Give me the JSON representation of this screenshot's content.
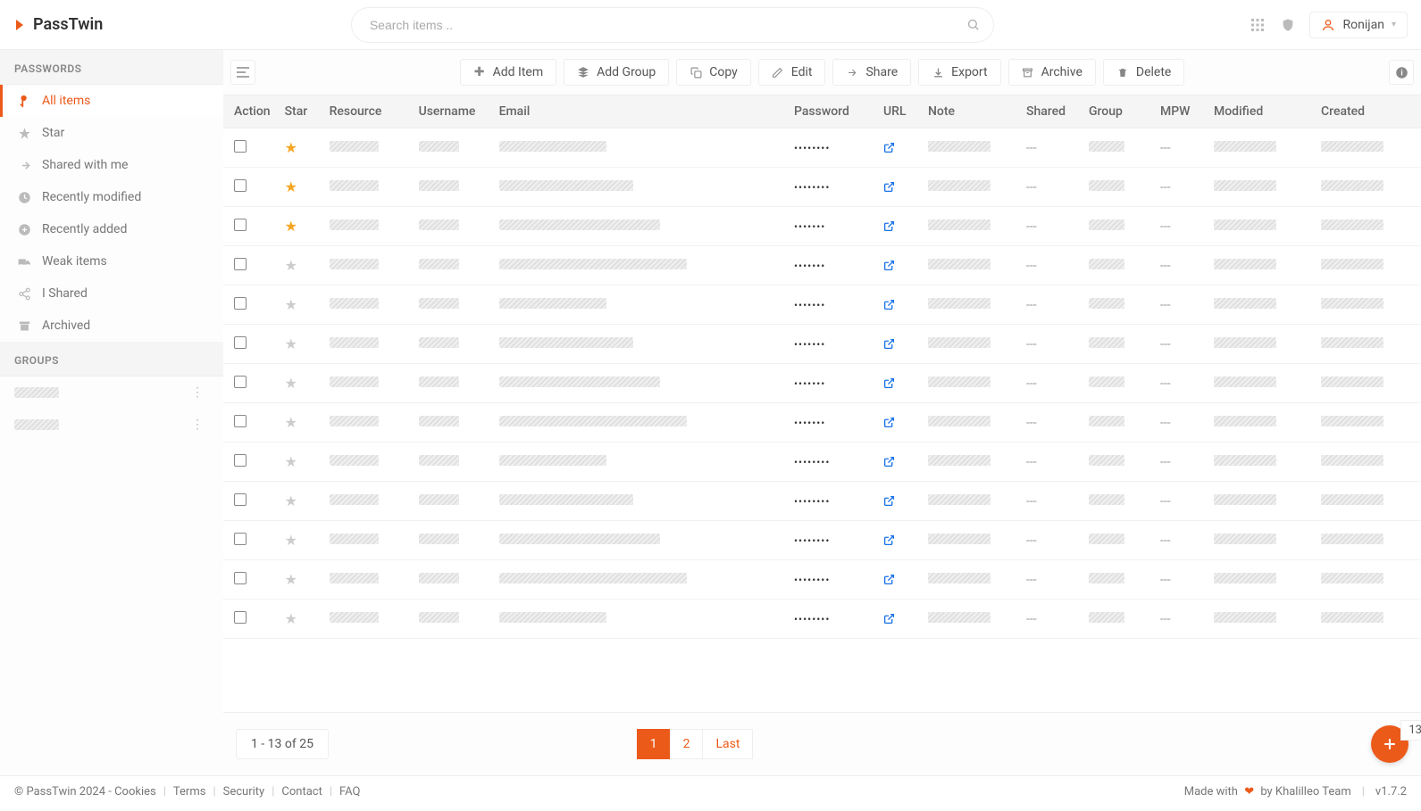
{
  "brand": "PassTwin",
  "search": {
    "placeholder": "Search items .."
  },
  "user": {
    "name": "Ronijan"
  },
  "sidebar": {
    "section_passwords": "PASSWORDS",
    "section_groups": "GROUPS",
    "items": [
      {
        "label": "All items",
        "icon": "key",
        "active": true
      },
      {
        "label": "Star",
        "icon": "star"
      },
      {
        "label": "Shared with me",
        "icon": "share-in"
      },
      {
        "label": "Recently modified",
        "icon": "clock"
      },
      {
        "label": "Recently added",
        "icon": "plus-circle"
      },
      {
        "label": "Weak items",
        "icon": "truck"
      },
      {
        "label": "I Shared",
        "icon": "share-out"
      },
      {
        "label": "Archived",
        "icon": "archive"
      }
    ],
    "groups": [
      {
        "redacted": true
      },
      {
        "redacted": true
      }
    ]
  },
  "toolbar": {
    "add_item": "Add Item",
    "add_group": "Add Group",
    "copy": "Copy",
    "edit": "Edit",
    "share": "Share",
    "export": "Export",
    "archive": "Archive",
    "delete": "Delete"
  },
  "columns": {
    "action": "Action",
    "star": "Star",
    "resource": "Resource",
    "username": "Username",
    "email": "Email",
    "password": "Password",
    "url": "URL",
    "note": "Note",
    "shared": "Shared",
    "group": "Group",
    "mpw": "MPW",
    "modified": "Modified",
    "created": "Created"
  },
  "rows": [
    {
      "starred": true,
      "password": "••••••••",
      "shared": "---",
      "mpw": "---"
    },
    {
      "starred": true,
      "password": "••••••••",
      "shared": "---",
      "mpw": "---"
    },
    {
      "starred": true,
      "password": "•••••••",
      "shared": "---",
      "mpw": "---"
    },
    {
      "starred": false,
      "password": "•••••••",
      "shared": "---",
      "mpw": "---"
    },
    {
      "starred": false,
      "password": "•••••••",
      "shared": "---",
      "mpw": "---"
    },
    {
      "starred": false,
      "password": "•••••••",
      "shared": "---",
      "mpw": "---"
    },
    {
      "starred": false,
      "password": "•••••••",
      "shared": "---",
      "mpw": "---"
    },
    {
      "starred": false,
      "password": "•••••••",
      "shared": "---",
      "mpw": "---"
    },
    {
      "starred": false,
      "password": "••••••••",
      "shared": "---",
      "mpw": "---"
    },
    {
      "starred": false,
      "password": "••••••••",
      "shared": "---",
      "mpw": "---"
    },
    {
      "starred": false,
      "password": "••••••••",
      "shared": "---",
      "mpw": "---"
    },
    {
      "starred": false,
      "password": "••••••••",
      "shared": "---",
      "mpw": "---"
    },
    {
      "starred": false,
      "password": "••••••••",
      "shared": "---",
      "mpw": "---"
    }
  ],
  "pagination": {
    "info": "1 - 13 of 25",
    "pages": [
      "1",
      "2"
    ],
    "last": "Last",
    "count": "13"
  },
  "footer": {
    "copyright": "© PassTwin 2024",
    "cookies": "Cookies",
    "terms": "Terms",
    "security": "Security",
    "contact": "Contact",
    "faq": "FAQ",
    "made_with": "Made with",
    "by": "by Khalilleo Team",
    "version": "v1.7.2"
  }
}
